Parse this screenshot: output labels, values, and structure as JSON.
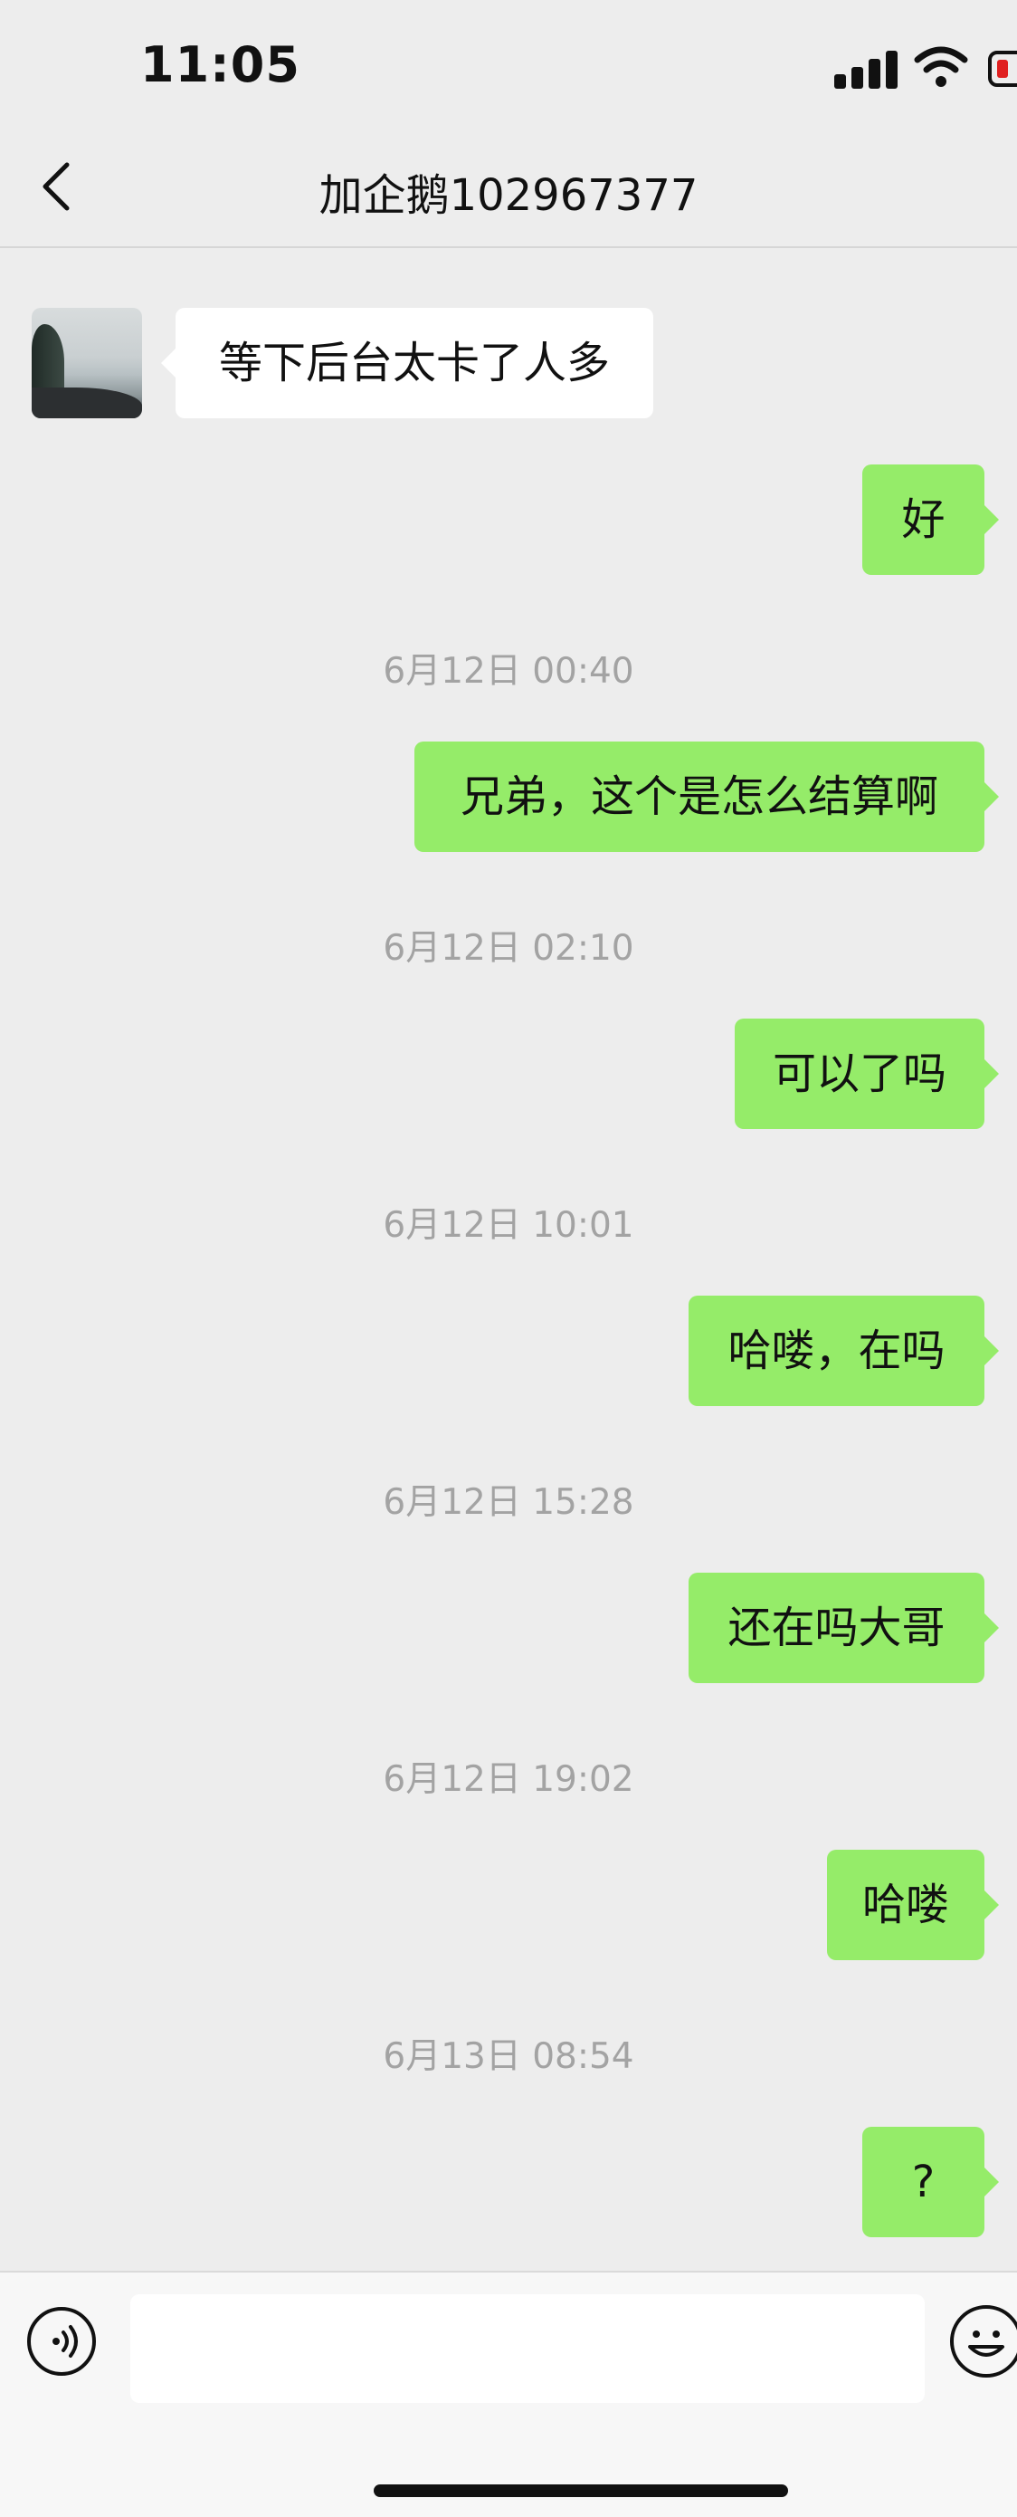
{
  "status_bar": {
    "time": "11:05"
  },
  "nav": {
    "title": "加企鹅102967377"
  },
  "messages": [
    {
      "type": "incoming",
      "text": "等下后台太卡了人多"
    },
    {
      "type": "outgoing",
      "text": "好"
    },
    {
      "type": "timestamp",
      "text": "6月12日 00:40"
    },
    {
      "type": "outgoing",
      "text": "兄弟，这个是怎么结算啊"
    },
    {
      "type": "timestamp",
      "text": "6月12日 02:10"
    },
    {
      "type": "outgoing",
      "text": "可以了吗"
    },
    {
      "type": "timestamp",
      "text": "6月12日 10:01"
    },
    {
      "type": "outgoing",
      "text": "哈喽，在吗"
    },
    {
      "type": "timestamp",
      "text": "6月12日 15:28"
    },
    {
      "type": "outgoing",
      "text": "还在吗大哥"
    },
    {
      "type": "timestamp",
      "text": "6月12日 19:02"
    },
    {
      "type": "outgoing",
      "text": "哈喽"
    },
    {
      "type": "timestamp",
      "text": "6月13日 08:54"
    },
    {
      "type": "outgoing",
      "text": "?"
    }
  ],
  "input": {
    "value": "",
    "placeholder": ""
  },
  "colors": {
    "outgoing_bubble": "#95ec69",
    "incoming_bubble": "#ffffff",
    "background": "#ededed",
    "timestamp": "#a3a3a3"
  }
}
